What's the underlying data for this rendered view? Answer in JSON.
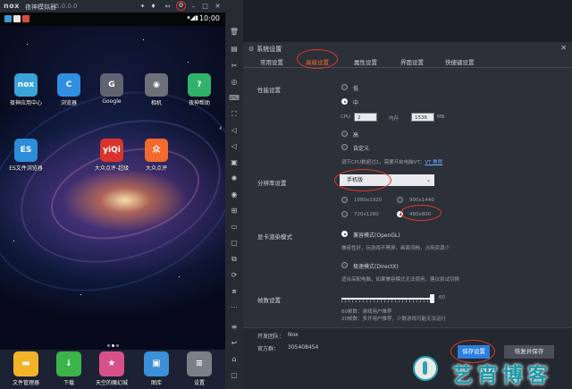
{
  "emulator": {
    "logo": "nox",
    "name": "夜神模拟器",
    "version": "5.0.0.0"
  },
  "statusbar": {
    "time": "10:00"
  },
  "home_apps": [
    {
      "label": "夜神应用中心",
      "icon": "nox-app-center-icon",
      "glyph": "nox",
      "color": "#3aa3d8"
    },
    {
      "label": "浏览器",
      "icon": "browser-icon",
      "glyph": "C",
      "color": "#2f8fe0"
    },
    {
      "label": "Google",
      "icon": "google-folder-icon",
      "glyph": "G",
      "color": "#5f6470"
    },
    {
      "label": "相机",
      "icon": "camera-icon",
      "glyph": "◉",
      "color": "#6c7078"
    },
    {
      "label": "夜神帮助",
      "icon": "nox-help-icon",
      "glyph": "?",
      "color": "#2fb36b"
    },
    {
      "label": "ES文件浏览器",
      "icon": "es-file-explorer-icon",
      "glyph": "ES",
      "color": "#2b8ddb"
    },
    {
      "label": "大众点评-超级",
      "icon": "dianping-super-icon",
      "glyph": "yiQi",
      "color": "#d9342b"
    },
    {
      "label": "大众点评",
      "icon": "dianping-icon",
      "glyph": "众",
      "color": "#f26a2d"
    }
  ],
  "dock_apps": [
    {
      "label": "文件管理器",
      "icon": "file-manager-icon",
      "glyph": "▬",
      "color": "#f3b328"
    },
    {
      "label": "下载",
      "icon": "download-icon",
      "glyph": "↓",
      "color": "#3bb44a"
    },
    {
      "label": "天空的魔幻城",
      "icon": "game-icon",
      "glyph": "★",
      "color": "#d8508a"
    },
    {
      "label": "图库",
      "icon": "gallery-icon",
      "glyph": "▣",
      "color": "#3c8fd8"
    },
    {
      "label": "设置",
      "icon": "settings-icon",
      "glyph": "≡",
      "color": "#7a7f88"
    }
  ],
  "settings": {
    "title": "系统设置",
    "tabs": [
      "常用设置",
      "高级设置",
      "属性设置",
      "界面设置",
      "快捷键设置"
    ],
    "active_tab": 1,
    "performance": {
      "label": "性能设置",
      "low": "低",
      "mid": "中",
      "cpu_label": "CPU",
      "cpu_value": "2",
      "mem_label": "内存",
      "mem_value": "1536",
      "mem_unit": "MB",
      "high": "高",
      "custom": "自定义",
      "hint": "调节CPU数超过1，需要开启电脑VT：",
      "vt_link": "VT 教程"
    },
    "resolution": {
      "label": "分辨率设置",
      "selected": "手机版",
      "options": [
        "1080x1920",
        "900x1440",
        "720x1280",
        "480x800"
      ],
      "checked": "480x800"
    },
    "render": {
      "label": "显卡渲染模式",
      "compat": "兼容模式(OpenGL)",
      "compat_desc": "兼容性好，玩游戏不黑屏，画面流畅，占用资源少",
      "speed": "极速模式(DirectX)",
      "speed_desc": "适合高配电脑，如果兼容模式无法使用，建议尝试切换"
    },
    "fps": {
      "label": "帧数设置",
      "value": 60,
      "max": 60,
      "note1": "60帧数：游戏用户推荐",
      "note2": "20帧数：多开用户推荐，少数游戏可能无法运行"
    },
    "footer": {
      "dev_team_label": "开发团队：",
      "dev_team": "Nox",
      "qq_group_label": "官方群：",
      "qq_group": "305408454",
      "save": "保存设置",
      "restore": "恢复并保存"
    }
  },
  "watermark": "艺宵博客",
  "colors": {
    "accent_tab": "#ff6a2b",
    "primary_button": "#2a7fe0",
    "annotation_ring": "#e03a2c"
  }
}
